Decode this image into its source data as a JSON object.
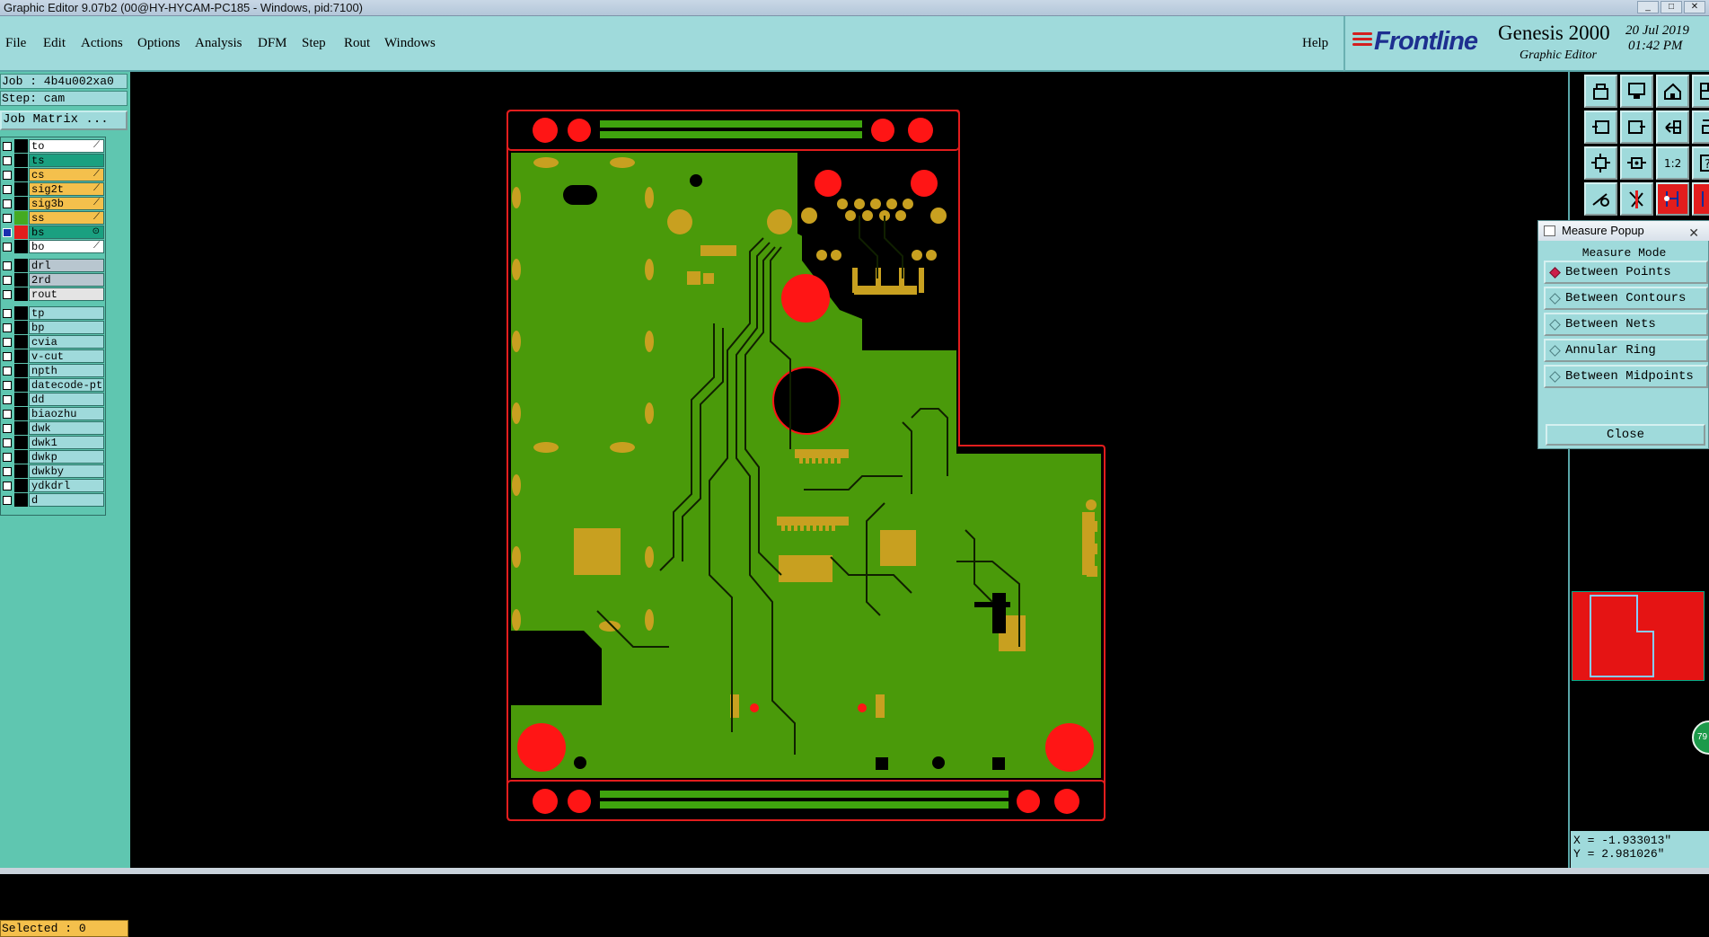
{
  "window": {
    "title": "Graphic Editor 9.07b2 (00@HY-HYCAM-PC185 - Windows, pid:7100)",
    "controls": [
      "_",
      "□",
      "✕"
    ]
  },
  "menu": [
    {
      "label": "File"
    },
    {
      "label": "Edit"
    },
    {
      "label": "Actions"
    },
    {
      "label": "Options"
    },
    {
      "label": "Analysis"
    },
    {
      "label": "DFM"
    },
    {
      "label": "Step"
    },
    {
      "label": "Rout"
    },
    {
      "label": "Windows"
    }
  ],
  "help_label": "Help",
  "brand": {
    "logo_text": "Frontline",
    "product": "Genesis 2000",
    "subtitle": "Graphic Editor",
    "date": "20 Jul 2019",
    "time": "01:42 PM"
  },
  "job": {
    "job_label": "Job : 4b4u002xa0",
    "step_label": "Step: cam",
    "matrix_button": "Job Matrix ..."
  },
  "layers": [
    {
      "name": "to",
      "color": "#ffffff",
      "swatch": "#000000",
      "mark": "⟋"
    },
    {
      "name": "ts",
      "color": "#1aa080",
      "swatch": "#000000",
      "mark": ""
    },
    {
      "name": "cs",
      "color": "#f4c04c",
      "swatch": "#000000",
      "mark": "⟋"
    },
    {
      "name": "sig2t",
      "color": "#f4c04c",
      "swatch": "#000000",
      "mark": "⟋"
    },
    {
      "name": "sig3b",
      "color": "#f4c04c",
      "swatch": "#000000",
      "mark": "⟋"
    },
    {
      "name": "ss",
      "color": "#f4c04c",
      "swatch": "#44aa22",
      "mark": "⟋"
    },
    {
      "name": "bs",
      "color": "#1aa080",
      "swatch": "#e21d1d",
      "mark": "⊙",
      "selected": true
    },
    {
      "name": "bo",
      "color": "#ffffff",
      "swatch": "#000000",
      "mark": "⟋"
    },
    {
      "name": "drl",
      "color": "#b8c6cf",
      "swatch": "#000000",
      "mark": "",
      "gap": true
    },
    {
      "name": "2rd",
      "color": "#b8c6cf",
      "swatch": "#000000",
      "mark": ""
    },
    {
      "name": "rout",
      "color": "#e4e4e4",
      "swatch": "#000000",
      "mark": ""
    },
    {
      "name": "tp",
      "color": "#9fdadb",
      "swatch": "#000000",
      "mark": "",
      "gap": true
    },
    {
      "name": "bp",
      "color": "#9fdadb",
      "swatch": "#000000",
      "mark": ""
    },
    {
      "name": "cvia",
      "color": "#9fdadb",
      "swatch": "#000000",
      "mark": ""
    },
    {
      "name": "v-cut",
      "color": "#9fdadb",
      "swatch": "#000000",
      "mark": ""
    },
    {
      "name": "npth",
      "color": "#9fdadb",
      "swatch": "#000000",
      "mark": ""
    },
    {
      "name": "datecode-pt",
      "color": "#9fdadb",
      "swatch": "#000000",
      "mark": ""
    },
    {
      "name": "dd",
      "color": "#9fdadb",
      "swatch": "#000000",
      "mark": ""
    },
    {
      "name": "biaozhu",
      "color": "#9fdadb",
      "swatch": "#000000",
      "mark": ""
    },
    {
      "name": "dwk",
      "color": "#9fdadb",
      "swatch": "#000000",
      "mark": ""
    },
    {
      "name": "dwk1",
      "color": "#9fdadb",
      "swatch": "#000000",
      "mark": ""
    },
    {
      "name": "dwkp",
      "color": "#9fdadb",
      "swatch": "#000000",
      "mark": ""
    },
    {
      "name": "dwkby",
      "color": "#9fdadb",
      "swatch": "#000000",
      "mark": ""
    },
    {
      "name": "ydkdrl",
      "color": "#9fdadb",
      "swatch": "#000000",
      "mark": ""
    },
    {
      "name": "d",
      "color": "#9fdadb",
      "swatch": "#000000",
      "mark": ""
    }
  ],
  "selected_label": "Selected : 0",
  "toolbar_icons": [
    "open-job-icon",
    "save-icon",
    "home-icon",
    "window-icon",
    "fit-left-icon",
    "fit-right-icon",
    "flip-icon",
    "snap-icon",
    "zoom-fit-icon",
    "zoom-center-icon",
    "scale-icon",
    "help-icon",
    "measure-tool-icon",
    "cut-icon",
    "net-highlight-icon",
    "net-trace-icon"
  ],
  "toolbar_scale_label": "1:2",
  "measure": {
    "title": "Measure Popup",
    "header": "Measure Mode",
    "options": [
      {
        "label": "Between Points",
        "selected": true
      },
      {
        "label": "Between Contours",
        "selected": false
      },
      {
        "label": "Between Nets",
        "selected": false
      },
      {
        "label": "Annular Ring",
        "selected": false
      },
      {
        "label": "Between Midpoints",
        "selected": false
      }
    ],
    "close_label": "Close"
  },
  "coords": {
    "x": "X = -1.933013\"",
    "y": "Y = 2.981026\""
  },
  "zoom_badge": "79",
  "colors": {
    "panel": "#9fdadb",
    "board_fill": "#4a9a0a",
    "copper": "#c8a020",
    "outline": "#e21d1d",
    "pad_red": "#ff1515"
  }
}
